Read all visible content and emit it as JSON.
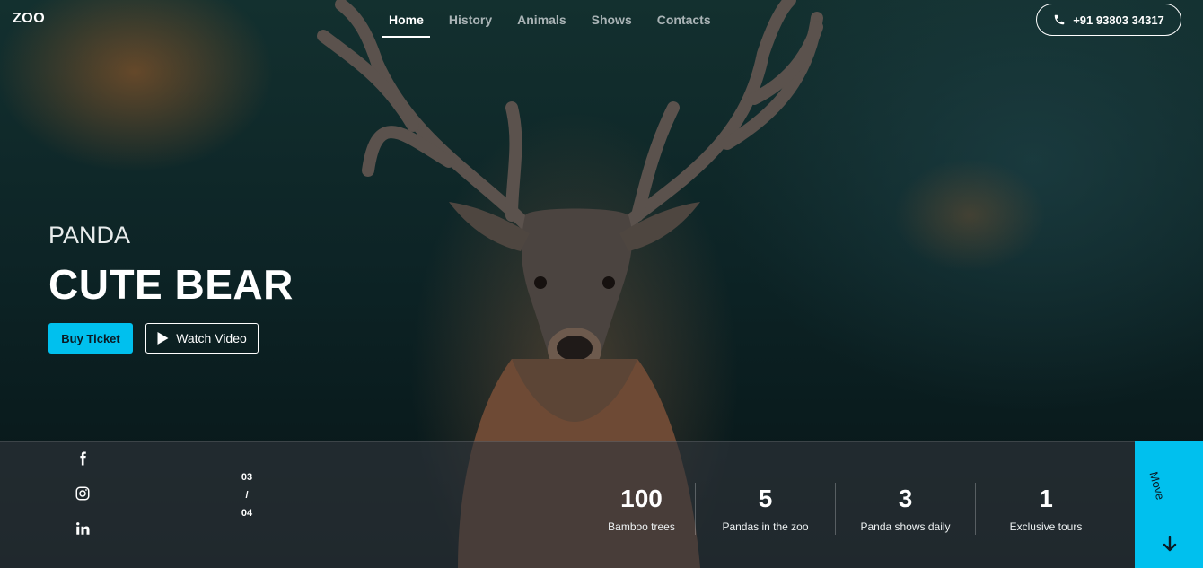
{
  "header": {
    "logo": "ZOO",
    "nav": [
      "Home",
      "History",
      "Animals",
      "Shows",
      "Contacts"
    ],
    "active_nav": "Home",
    "phone": "+91 93803 34317"
  },
  "hero": {
    "subtitle": "PANDA",
    "title": "CUTE BEAR",
    "buy_ticket": "Buy Ticket",
    "watch_video": "Watch Video"
  },
  "social": [
    "facebook-icon",
    "instagram-icon",
    "linkedin-icon"
  ],
  "slider": {
    "current": "03",
    "separator": "/",
    "total": "04"
  },
  "stats": [
    {
      "value": "100",
      "label": "Bamboo trees"
    },
    {
      "value": "5",
      "label": "Pandas in the zoo"
    },
    {
      "value": "3",
      "label": "Panda shows daily"
    },
    {
      "value": "1",
      "label": "Exclusive tours"
    }
  ],
  "move": {
    "label": "Move"
  },
  "colors": {
    "accent": "#00c0ee",
    "text": "#ffffff"
  }
}
